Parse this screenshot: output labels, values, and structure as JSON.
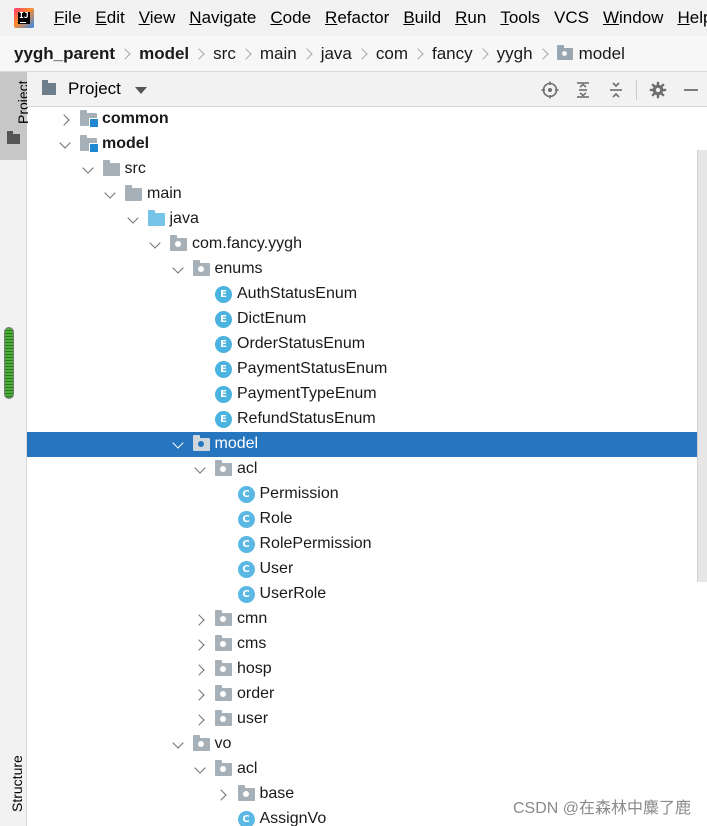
{
  "menubar": {
    "items": [
      {
        "ul": "F",
        "rest": "ile"
      },
      {
        "ul": "E",
        "rest": "dit"
      },
      {
        "ul": "V",
        "rest": "iew"
      },
      {
        "ul": "N",
        "rest": "avigate"
      },
      {
        "ul": "C",
        "rest": "ode"
      },
      {
        "ul": "R",
        "rest": "efactor"
      },
      {
        "ul": "B",
        "rest": "uild"
      },
      {
        "ul": "R",
        "rest": "un"
      },
      {
        "ul": "T",
        "rest": "ools"
      },
      {
        "ul": "",
        "rest": "VCS"
      },
      {
        "ul": "W",
        "rest": "indow"
      },
      {
        "ul": "H",
        "rest": "elp"
      }
    ]
  },
  "breadcrumb": [
    "yygh_parent",
    "model",
    "src",
    "main",
    "java",
    "com",
    "fancy",
    "yygh",
    "model"
  ],
  "toolstrip": {
    "project_label": "Project",
    "structure_label": "Structure"
  },
  "panel": {
    "title": "Project"
  },
  "tree": [
    {
      "label": "common",
      "depth": 0,
      "icon": "module",
      "expanded": false,
      "bold": true
    },
    {
      "label": "model",
      "depth": 0,
      "icon": "module",
      "expanded": true,
      "bold": true
    },
    {
      "label": "src",
      "depth": 1,
      "icon": "folder",
      "expanded": true
    },
    {
      "label": "main",
      "depth": 2,
      "icon": "folder",
      "expanded": true
    },
    {
      "label": "java",
      "depth": 3,
      "icon": "source",
      "expanded": true
    },
    {
      "label": "com.fancy.yygh",
      "depth": 4,
      "icon": "package",
      "expanded": true
    },
    {
      "label": "enums",
      "depth": 5,
      "icon": "package",
      "expanded": true
    },
    {
      "label": "AuthStatusEnum",
      "depth": 6,
      "icon": "enum"
    },
    {
      "label": "DictEnum",
      "depth": 6,
      "icon": "enum"
    },
    {
      "label": "OrderStatusEnum",
      "depth": 6,
      "icon": "enum"
    },
    {
      "label": "PaymentStatusEnum",
      "depth": 6,
      "icon": "enum"
    },
    {
      "label": "PaymentTypeEnum",
      "depth": 6,
      "icon": "enum"
    },
    {
      "label": "RefundStatusEnum",
      "depth": 6,
      "icon": "enum"
    },
    {
      "label": "model",
      "depth": 5,
      "icon": "package",
      "expanded": true,
      "selected": true
    },
    {
      "label": "acl",
      "depth": 6,
      "icon": "package",
      "expanded": true
    },
    {
      "label": "Permission",
      "depth": 7,
      "icon": "class"
    },
    {
      "label": "Role",
      "depth": 7,
      "icon": "class"
    },
    {
      "label": "RolePermission",
      "depth": 7,
      "icon": "class"
    },
    {
      "label": "User",
      "depth": 7,
      "icon": "class"
    },
    {
      "label": "UserRole",
      "depth": 7,
      "icon": "class"
    },
    {
      "label": "cmn",
      "depth": 6,
      "icon": "package",
      "expanded": false
    },
    {
      "label": "cms",
      "depth": 6,
      "icon": "package",
      "expanded": false
    },
    {
      "label": "hosp",
      "depth": 6,
      "icon": "package",
      "expanded": false
    },
    {
      "label": "order",
      "depth": 6,
      "icon": "package",
      "expanded": false
    },
    {
      "label": "user",
      "depth": 6,
      "icon": "package",
      "expanded": false
    },
    {
      "label": "vo",
      "depth": 5,
      "icon": "package",
      "expanded": true
    },
    {
      "label": "acl",
      "depth": 6,
      "icon": "package",
      "expanded": true
    },
    {
      "label": "base",
      "depth": 7,
      "icon": "package",
      "expanded": false
    },
    {
      "label": "AssignVo",
      "depth": 7,
      "icon": "class"
    }
  ],
  "watermark": "CSDN @在森林中麋了鹿",
  "colors": {
    "selection": "#2675bf",
    "folder": "#a5b0b8",
    "source_folder": "#76c3e8",
    "badge": "#5bb8e5"
  }
}
